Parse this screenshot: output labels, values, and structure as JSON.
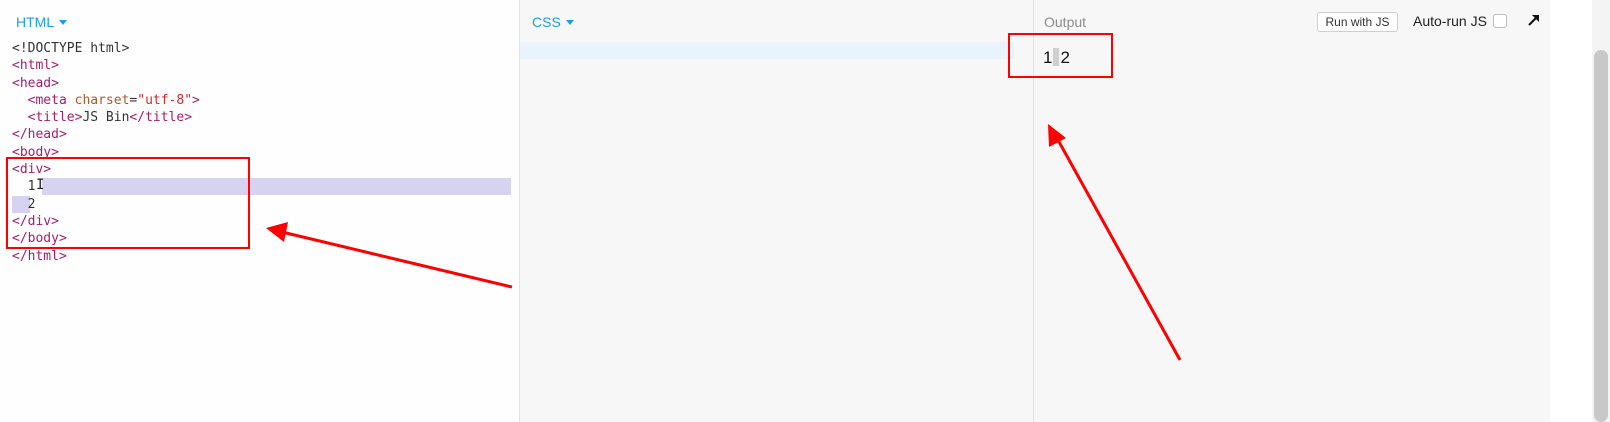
{
  "html_panel": {
    "label": "HTML"
  },
  "css_panel": {
    "label": "CSS"
  },
  "output_panel": {
    "label": "Output",
    "run_button": "Run with JS",
    "autorun_label": "Auto-run JS",
    "autorun_checked": false,
    "rendered_text_1": "1",
    "rendered_text_2": "2"
  },
  "code": {
    "l1": "<!DOCTYPE html>",
    "l2": "<html>",
    "l3": "<head>",
    "l4_open": "  <meta ",
    "l4_attr": "charset",
    "l4_eq": "=",
    "l4_val": "\"utf-8\"",
    "l4_close": ">",
    "l5_open": "  <title>",
    "l5_text": "JS Bin",
    "l5_close": "</title>",
    "l6": "</head>",
    "l7": "<body>",
    "l8": "<div>",
    "l9": "  1",
    "l10": "  2",
    "l11": "</div>",
    "l12": "</body>",
    "l13": "</html>"
  },
  "colors": {
    "accent": "#1a9ef0",
    "annotation": "#ff0000",
    "selection": "#d5d3ef"
  },
  "icons": {
    "popout": "popout-arrow-icon",
    "caret": "caret-down-icon"
  }
}
